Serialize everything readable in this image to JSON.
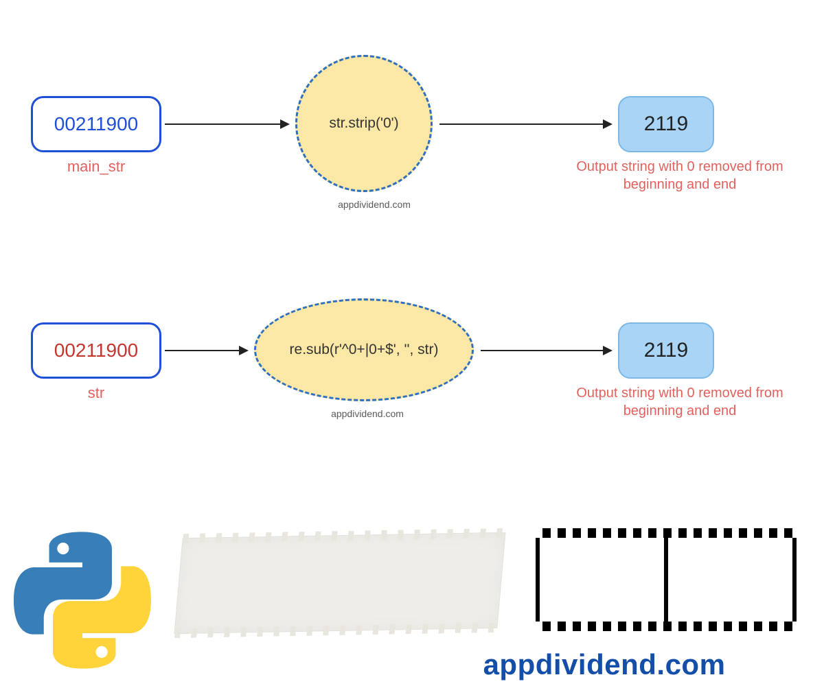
{
  "row1": {
    "input_value": "00211900",
    "input_label": "main_str",
    "operation": "str.strip('0')",
    "op_caption": "appdividend.com",
    "output_value": "2119",
    "output_label": "Output string with 0 removed from beginning and end"
  },
  "row2": {
    "input_value": "00211900",
    "input_label": "str",
    "operation": "re.sub(r'^0+|0+$', '', str)",
    "op_caption": "appdividend.com",
    "output_value": "2119",
    "output_label": "Output string with 0 removed from beginning and end"
  },
  "brand": "appdividend.com"
}
